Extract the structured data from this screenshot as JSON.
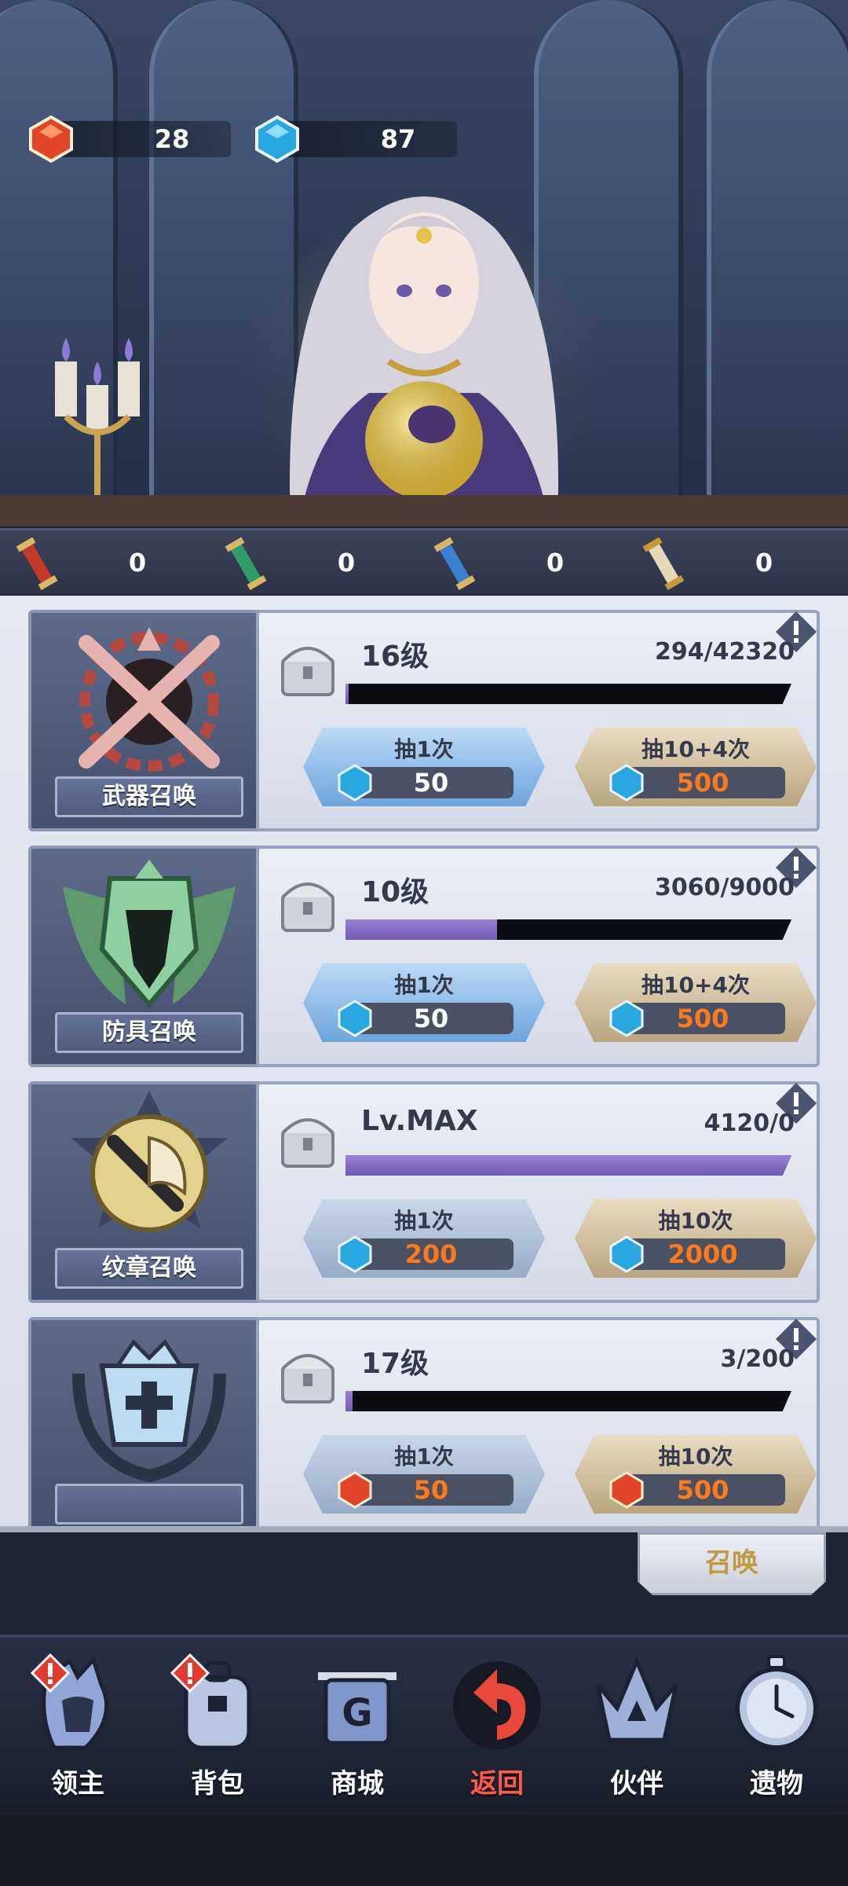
{
  "currencies": [
    {
      "name": "red-gem",
      "value": "28"
    },
    {
      "name": "blue-gem",
      "value": "87"
    }
  ],
  "scrolls": [
    {
      "name": "red-scroll",
      "count": "0"
    },
    {
      "name": "green-scroll",
      "count": "0"
    },
    {
      "name": "blue-scroll",
      "count": "0"
    },
    {
      "name": "gold-scroll",
      "count": "0"
    }
  ],
  "summons": [
    {
      "title": "武器召唤",
      "level": "16级",
      "progress_text": "294/42320",
      "progress": 0.007,
      "single_label": "抽1次",
      "single_cost": "50",
      "multi_label": "抽10+4次",
      "multi_cost": "500"
    },
    {
      "title": "防具召唤",
      "level": "10级",
      "progress_text": "3060/9000",
      "progress": 0.34,
      "single_label": "抽1次",
      "single_cost": "50",
      "multi_label": "抽10+4次",
      "multi_cost": "500"
    },
    {
      "title": "纹章召唤",
      "level": "Lv.MAX",
      "progress_text": "4120/0",
      "progress": 1.0,
      "single_label": "抽1次",
      "single_cost": "200",
      "multi_label": "抽10次",
      "multi_cost": "2000"
    },
    {
      "title": "",
      "level": "17级",
      "progress_text": "3/200",
      "progress": 0.015,
      "single_label": "抽1次",
      "single_cost": "50",
      "multi_label": "抽10次",
      "multi_cost": "500"
    }
  ],
  "summon_tab": "召唤",
  "nav": [
    {
      "label": "领主",
      "icon": "lord-icon",
      "alert": true
    },
    {
      "label": "背包",
      "icon": "backpack-icon",
      "alert": true
    },
    {
      "label": "商城",
      "icon": "shop-icon",
      "alert": false
    },
    {
      "label": "返回",
      "icon": "return-icon",
      "alert": false,
      "active": true
    },
    {
      "label": "伙伴",
      "icon": "partner-crown-icon",
      "alert": false
    },
    {
      "label": "遗物",
      "icon": "relic-watch-icon",
      "alert": false
    }
  ],
  "colors": {
    "accent_orange": "#ff7a1a",
    "active_nav": "#ff5a4a",
    "progress_purple": "#7f66c0"
  }
}
